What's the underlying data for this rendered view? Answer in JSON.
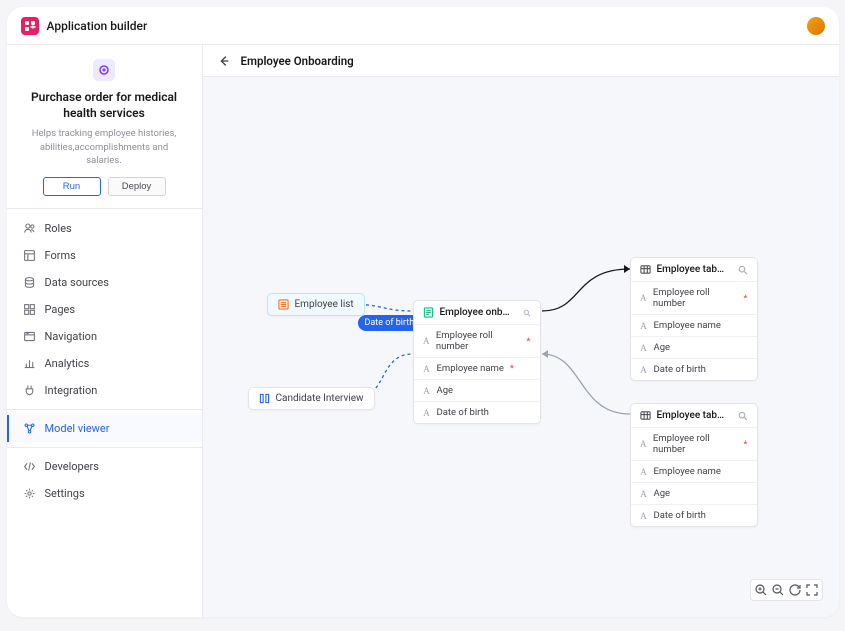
{
  "app": {
    "title": "Application builder"
  },
  "appCard": {
    "name": "Purchase order for medical health services",
    "desc": "Helps tracking employee histories, abilities,accomplishments and salaries.",
    "runLabel": "Run",
    "deployLabel": "Deploy"
  },
  "nav": {
    "items": [
      {
        "label": "Roles",
        "icon": "users"
      },
      {
        "label": "Forms",
        "icon": "layout"
      },
      {
        "label": "Data sources",
        "icon": "database"
      },
      {
        "label": "Pages",
        "icon": "grid"
      },
      {
        "label": "Navigation",
        "icon": "nav"
      },
      {
        "label": "Analytics",
        "icon": "chart"
      },
      {
        "label": "Integration",
        "icon": "plug"
      }
    ],
    "activeGroup": [
      {
        "label": "Model viewer",
        "icon": "model",
        "active": true
      }
    ],
    "bottomGroup": [
      {
        "label": "Developers",
        "icon": "code"
      },
      {
        "label": "Settings",
        "icon": "gear"
      }
    ]
  },
  "page": {
    "title": "Employee Onboarding"
  },
  "nodes": {
    "employeeList": {
      "label": "Employee list"
    },
    "candidateInterview": {
      "label": "Candidate Interview"
    },
    "badge": {
      "label": "Date of birth"
    },
    "onboard": {
      "title": "Employee onboard...",
      "fields": [
        {
          "label": "Employee roll number",
          "required": true
        },
        {
          "label": "Employee name",
          "required": true
        },
        {
          "label": "Age",
          "required": false
        },
        {
          "label": "Date of birth",
          "required": false
        }
      ]
    },
    "table1": {
      "title": "Employee tabl...",
      "fields": [
        {
          "label": "Employee roll number",
          "required": true
        },
        {
          "label": "Employee name",
          "required": false
        },
        {
          "label": "Age",
          "required": false
        },
        {
          "label": "Date of birth",
          "required": false
        }
      ]
    },
    "table2": {
      "title": "Employee tabl...",
      "fields": [
        {
          "label": "Employee roll number",
          "required": true
        },
        {
          "label": "Employee name",
          "required": false
        },
        {
          "label": "Age",
          "required": false
        },
        {
          "label": "Date of birth",
          "required": false
        }
      ]
    }
  },
  "toolbar": {
    "tools": [
      "zoom-in",
      "zoom-out",
      "refresh",
      "fullscreen"
    ]
  },
  "colors": {
    "accent": "#2563eb",
    "brand": "#e91e63"
  }
}
